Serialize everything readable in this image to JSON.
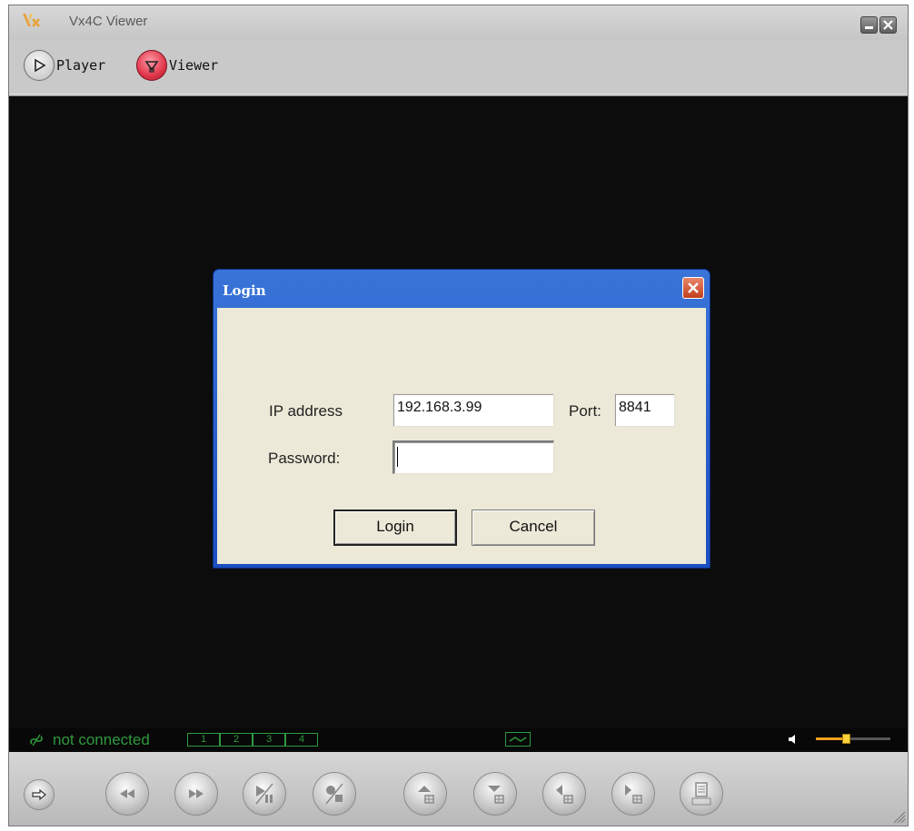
{
  "window": {
    "title": "Vx4C Viewer",
    "minimize_label": "–",
    "close_label": "×"
  },
  "modes": {
    "player_label": "Player",
    "viewer_label": "Viewer"
  },
  "status": {
    "connection_text": "not connected",
    "channels": [
      "1",
      "2",
      "3",
      "4"
    ]
  },
  "login_dialog": {
    "title": "Login",
    "ip_label": "IP address",
    "ip_value": "192.168.3.99",
    "port_label": "Port:",
    "port_value": "8841",
    "password_label": "Password:",
    "password_value": "",
    "login_button": "Login",
    "cancel_button": "Cancel"
  },
  "volume": {
    "level": 0.4
  },
  "colors": {
    "video_bg": "#0c0c0c",
    "status_green": "#2e9a3e",
    "dialog_blue": "#2457c9",
    "dialog_face": "#ece9d8",
    "viewer_active": "#e0364a"
  },
  "controls": [
    "arrow-right-icon",
    "rewind-icon",
    "fast-forward-icon",
    "play-pause-icon",
    "record-stop-icon",
    "channel-up-icon",
    "channel-down-icon",
    "channel-prev-icon",
    "channel-next-icon",
    "menu-icon"
  ]
}
